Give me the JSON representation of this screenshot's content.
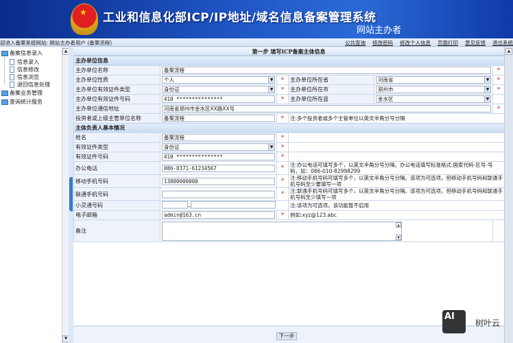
{
  "header": {
    "title": "工业和信息化部ICP/IP地址/域名信息备案管理系统",
    "subtitle": "网站主办者"
  },
  "topbar": {
    "welcome": "迎进入备案系统网站: 网站主办者用户 (备案流程)",
    "links": [
      "公共查询",
      "修改密码",
      "修改个人信息",
      "页面打印",
      "意见反馈",
      "退出系统"
    ]
  },
  "sidebar": {
    "items": [
      {
        "label": "备案信息录入",
        "children": [
          "信息录入",
          "信息修改",
          "信息浏览",
          "退回信息处理"
        ]
      },
      {
        "label": "备案业务管理"
      },
      {
        "label": "查询统计服务"
      }
    ]
  },
  "form": {
    "step_title": "第一步   填写ICP备案主体信息",
    "section1": "主办单位信息",
    "unit_name_label": "主办单位名称",
    "unit_name": "备案流程",
    "unit_nature_label": "主办单位性质",
    "unit_nature": "个人",
    "province_label": "主办单位所在省",
    "province": "河南省",
    "id_type_label": "主办单位有效证件类型",
    "id_type": "身份证",
    "city_label": "主办单位所在市",
    "city": "郑州市",
    "id_no_label": "主办单位有效证件号码",
    "id_no": "410 ***************",
    "county_label": "主办单位所在县",
    "county": "金水区",
    "address_label": "主办单位通信地址",
    "address": "河南省郑州市金水区XX路XX号",
    "investor_label": "投资者或上级主管单位名称",
    "investor": "备案流程",
    "investor_note": "注:多个投资者或多个主管单位以英文半角分号分隔",
    "section2": "主体负责人基本情况",
    "name_label": "姓名",
    "name": "备案流程",
    "p_id_type_label": "有效证件类型",
    "p_id_type": "身份证",
    "p_id_no_label": "有效证件号码",
    "p_id_no": "410 ***************",
    "office_phone_label": "办公电话",
    "office_phone": "086-0371-61234567",
    "office_phone_note": "注:办公电话可填写多个，以英文半角分号分隔。办公电话填写标准格式:国家代码-区号-号码，如：086-010-82998299",
    "mobile_label": "移动手机号码",
    "mobile": "13800000000",
    "mobile_note": "注:移动手机号码可填写多个，以英文半角分号分隔。该项为可选项，但移动手机号码和联通手机号码至少要填写一项",
    "unicom_label": "联通手机号码",
    "unicom": "",
    "unicom_note": "注:联通手机号码可填写多个，以英文半角分号分隔。该项为可选项，但移动手机号码和联通手机号码至少填写一项",
    "phs_label": "小灵通号码",
    "phs_note": "注:该项为可选项。该功能暂不启用",
    "email_label": "电子邮箱",
    "email": "admin@163.cn",
    "email_note": "例如:xyz@123.abc",
    "remark_label": "备注",
    "remark": "",
    "required_mark": "*"
  },
  "next_button": "下一步",
  "watermark": "AI 树叶云"
}
